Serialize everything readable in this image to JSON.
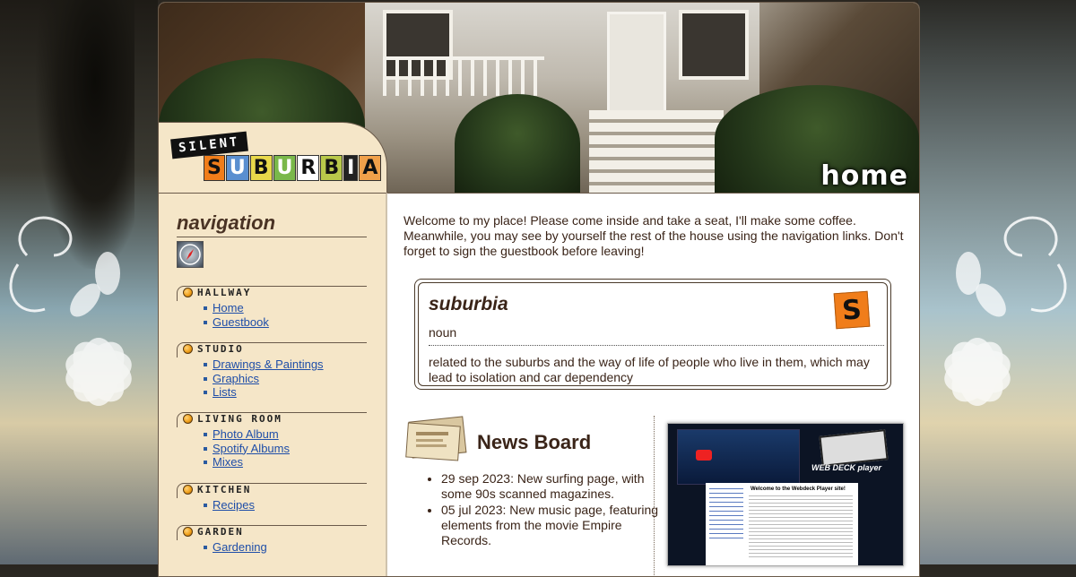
{
  "site": {
    "logo_top": "SILENT",
    "logo_letters": [
      "S",
      "U",
      "B",
      "U",
      "R",
      "B",
      "I",
      "A"
    ],
    "page_name": "home"
  },
  "sidebar": {
    "title": "navigation",
    "sections": [
      {
        "label": "HALLWAY",
        "items": [
          "Home",
          "Guestbook"
        ]
      },
      {
        "label": "STUDIO",
        "items": [
          "Drawings & Paintings",
          "Graphics",
          "Lists"
        ]
      },
      {
        "label": "LIVING ROOM",
        "items": [
          "Photo Album",
          "Spotify Albums",
          "Mixes"
        ]
      },
      {
        "label": "KITCHEN",
        "items": [
          "Recipes"
        ]
      },
      {
        "label": "GARDEN",
        "items": [
          "Gardening"
        ]
      }
    ]
  },
  "content": {
    "welcome": "Welcome to my place! Please come inside and take a seat, I'll make some coffee. Meanwhile, you may see by yourself the rest of the house using the navigation links. Don't forget to sign the guestbook before leaving!",
    "definition": {
      "word": "suburbia",
      "part_of_speech": "noun",
      "text": "related to the suburbs and the way of life of people who live in them, which may lead to isolation and car dependency",
      "icon_letter": "S"
    },
    "news": {
      "title": "News Board",
      "items": [
        "29 sep 2023: New surfing page, with some 90s scanned magazines.",
        "05 jul 2023: New music page, featuring elements from the movie Empire Records."
      ]
    },
    "screenshot": {
      "heading": "Welcome to the Webdeck Player site!",
      "brand": "WEB DECK player"
    }
  },
  "colors": {
    "sidebar_bg": "#f5e6c8",
    "link": "#1f4ea8",
    "text": "#3a2418",
    "accent_orange": "#f07d1a"
  }
}
